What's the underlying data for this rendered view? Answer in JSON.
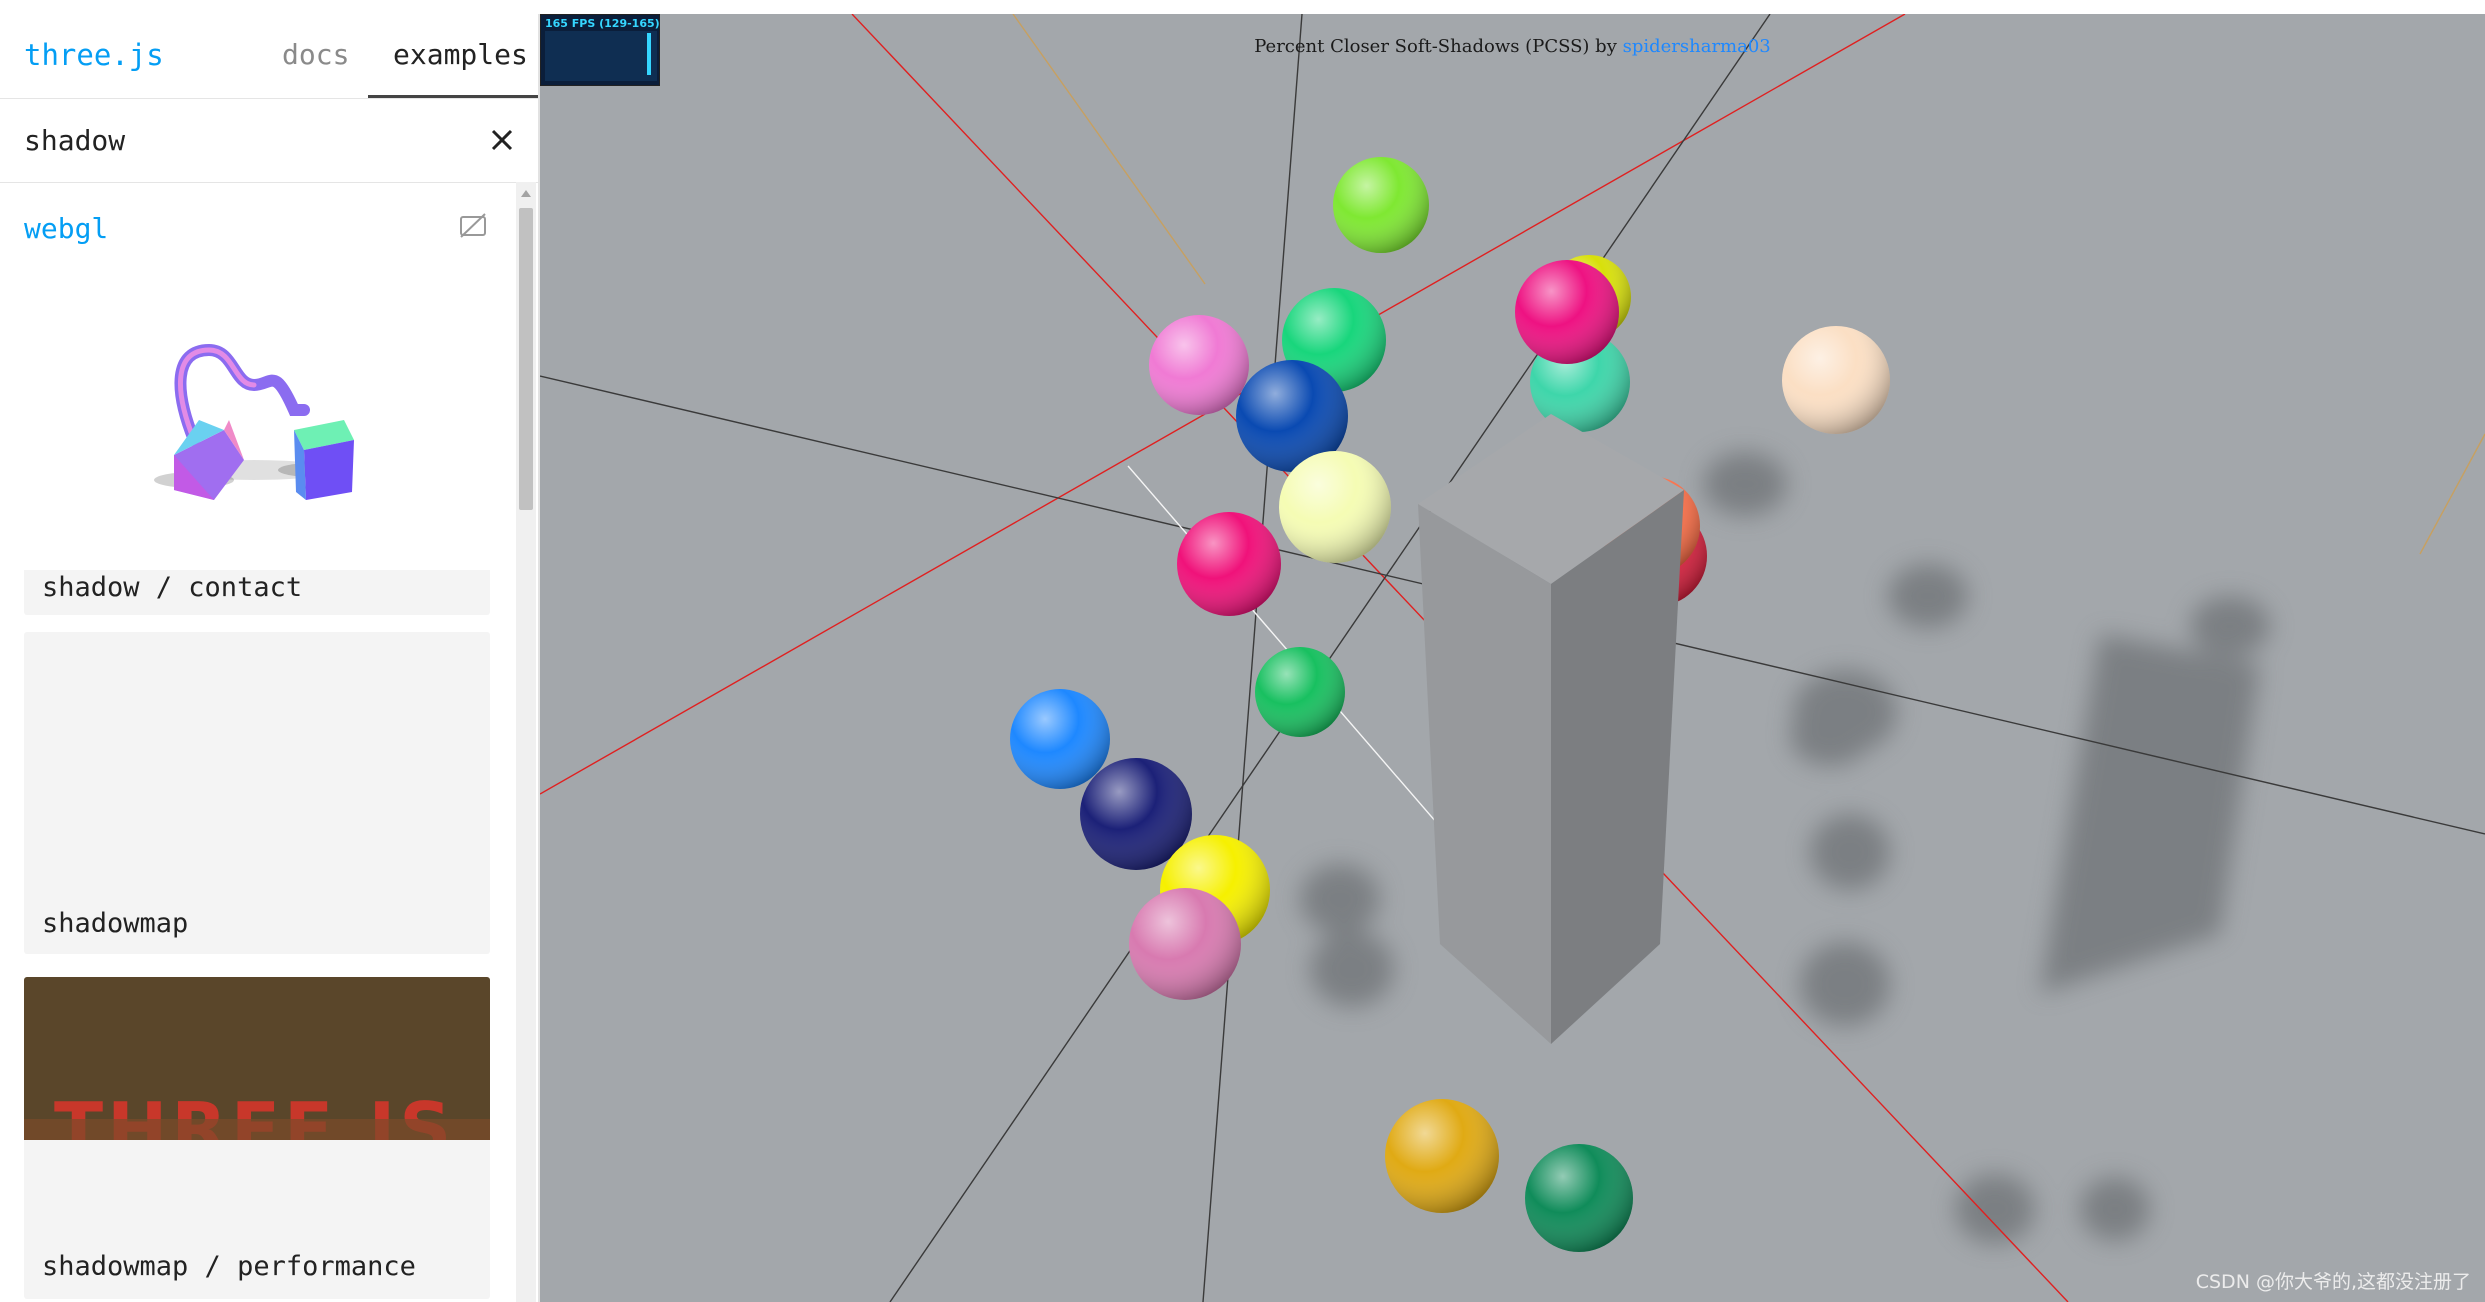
{
  "sidebar": {
    "brand": "three.js",
    "tabs": [
      {
        "label": "docs",
        "active": false
      },
      {
        "label": "examples",
        "active": true
      }
    ],
    "search": {
      "value": "shadow"
    },
    "category": "webgl",
    "examples": [
      {
        "label": "shadow / contact"
      },
      {
        "label": "shadowmap"
      },
      {
        "label": "shadowmap / performance",
        "thumbnail_text": "THREE.JS"
      }
    ]
  },
  "viewport": {
    "stats": "165 FPS (129-165)",
    "info": {
      "prefix": "Percent Closer Soft-Shadows (PCSS) by ",
      "author": "spidersharma03"
    },
    "background_color": "#a3a7ab",
    "watermark": "CSDN @你大爷的,这都没注册了"
  },
  "icons": {
    "clear": "close-icon",
    "category_toggle": "hide-thumbnails-icon",
    "scroll_up": "triangle-up-icon"
  }
}
